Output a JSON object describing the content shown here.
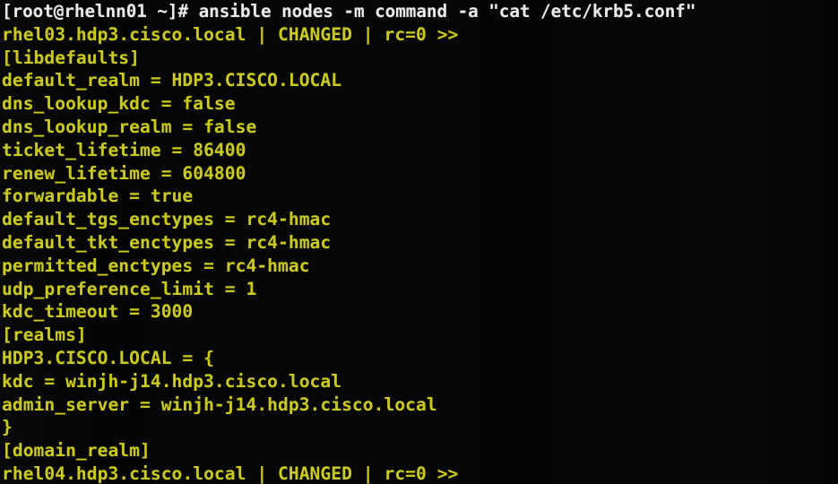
{
  "terminal": {
    "background_color": "#000000",
    "prompt_color": "#eaeaea",
    "output_color": "#c9c91f",
    "prompt_line": {
      "user": "root",
      "host": "rhelnn01",
      "cwd": "~",
      "symbol": "#",
      "full_text": "[root@rhelnn01 ~]# ansible nodes -m command -a \"cat /etc/krb5.conf\"",
      "command": "ansible nodes -m command -a \"cat /etc/krb5.conf\""
    },
    "lines": [
      {
        "kind": "prompt",
        "text": "[root@rhelnn01 ~]# ansible nodes -m command -a \"cat /etc/krb5.conf\""
      },
      {
        "kind": "output",
        "text": "rhel03.hdp3.cisco.local | CHANGED | rc=0 >>"
      },
      {
        "kind": "output",
        "text": "[libdefaults]"
      },
      {
        "kind": "output",
        "text": "default_realm = HDP3.CISCO.LOCAL"
      },
      {
        "kind": "output",
        "text": "dns_lookup_kdc = false"
      },
      {
        "kind": "output",
        "text": "dns_lookup_realm = false"
      },
      {
        "kind": "output",
        "text": "ticket_lifetime = 86400"
      },
      {
        "kind": "output",
        "text": "renew_lifetime = 604800"
      },
      {
        "kind": "output",
        "text": "forwardable = true"
      },
      {
        "kind": "output",
        "text": "default_tgs_enctypes = rc4-hmac"
      },
      {
        "kind": "output",
        "text": "default_tkt_enctypes = rc4-hmac"
      },
      {
        "kind": "output",
        "text": "permitted_enctypes = rc4-hmac"
      },
      {
        "kind": "output",
        "text": "udp_preference_limit = 1"
      },
      {
        "kind": "output",
        "text": "kdc_timeout = 3000"
      },
      {
        "kind": "output",
        "text": "[realms]"
      },
      {
        "kind": "output",
        "text": "HDP3.CISCO.LOCAL = {"
      },
      {
        "kind": "output",
        "text": "kdc = winjh-j14.hdp3.cisco.local"
      },
      {
        "kind": "output",
        "text": "admin_server = winjh-j14.hdp3.cisco.local"
      },
      {
        "kind": "output",
        "text": "}"
      },
      {
        "kind": "output",
        "text": "[domain_realm]"
      },
      {
        "kind": "output",
        "text": "rhel04.hdp3.cisco.local | CHANGED | rc=0 >>"
      }
    ],
    "hosts": [
      {
        "name": "rhel03.hdp3.cisco.local",
        "status": "CHANGED",
        "rc": "0"
      },
      {
        "name": "rhel04.hdp3.cisco.local",
        "status": "CHANGED",
        "rc": "0"
      }
    ],
    "krb5_conf": {
      "libdefaults": {
        "default_realm": "HDP3.CISCO.LOCAL",
        "dns_lookup_kdc": "false",
        "dns_lookup_realm": "false",
        "ticket_lifetime": "86400",
        "renew_lifetime": "604800",
        "forwardable": "true",
        "default_tgs_enctypes": "rc4-hmac",
        "default_tkt_enctypes": "rc4-hmac",
        "permitted_enctypes": "rc4-hmac",
        "udp_preference_limit": "1",
        "kdc_timeout": "3000"
      },
      "realms": {
        "HDP3.CISCO.LOCAL": {
          "kdc": "winjh-j14.hdp3.cisco.local",
          "admin_server": "winjh-j14.hdp3.cisco.local"
        }
      },
      "domain_realm": {}
    }
  }
}
